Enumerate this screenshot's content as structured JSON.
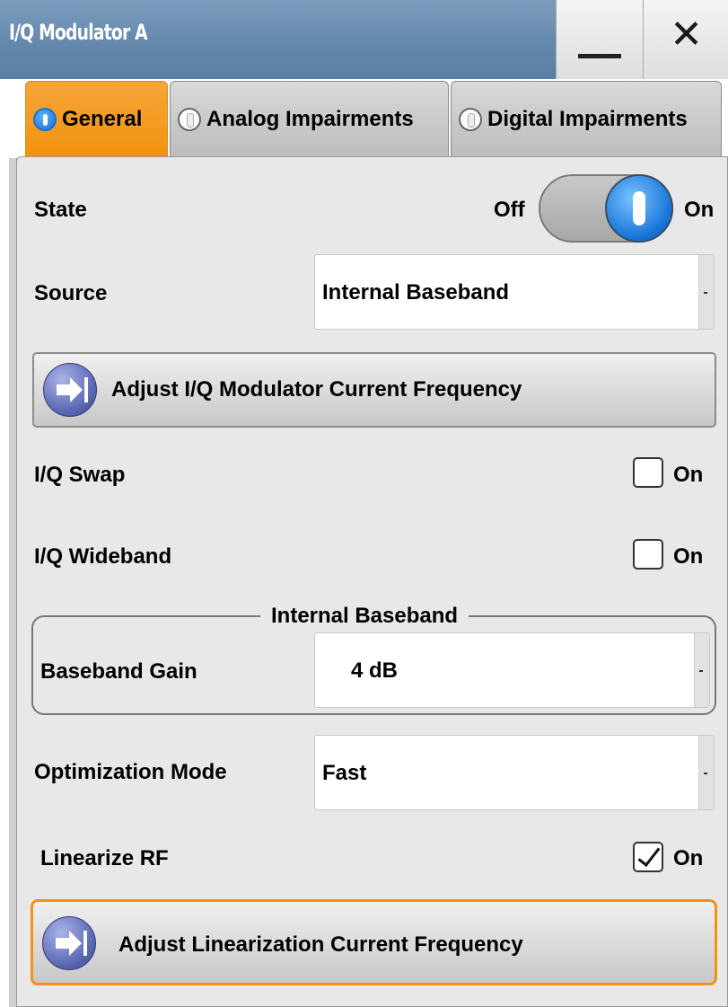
{
  "window": {
    "title": "I/Q Modulator A",
    "minimize_icon": "minimize-icon",
    "close_symbol": "✕"
  },
  "tabs": [
    {
      "label": "General",
      "active": true
    },
    {
      "label": "Analog Impairments",
      "active": false
    },
    {
      "label": "Digital Impairments",
      "active": false
    }
  ],
  "general": {
    "state": {
      "label": "State",
      "off_label": "Off",
      "on_label": "On",
      "value": "On"
    },
    "source": {
      "label": "Source",
      "value": "Internal Baseband"
    },
    "adjust_iq_button": "Adjust I/Q Modulator Current Frequency",
    "iq_swap": {
      "label": "I/Q Swap",
      "checkbox_label": "On",
      "checked": false
    },
    "iq_wideband": {
      "label": "I/Q Wideband",
      "checkbox_label": "On",
      "checked": false
    },
    "internal_baseband": {
      "group_title": "Internal Baseband",
      "baseband_gain": {
        "label": "Baseband Gain",
        "value": "4 dB"
      }
    },
    "optimization_mode": {
      "label": "Optimization Mode",
      "value": "Fast"
    },
    "linearize_rf": {
      "label": "Linearize RF",
      "checkbox_label": "On",
      "checked": true
    },
    "adjust_linearization_button": "Adjust Linearization Current Frequency"
  },
  "colors": {
    "title_bar": "#6488ac",
    "active_tab": "#f29318",
    "toggle_knob": "#1572d6",
    "panel_bg": "#e8e8e8",
    "focus_border": "#f29318"
  }
}
